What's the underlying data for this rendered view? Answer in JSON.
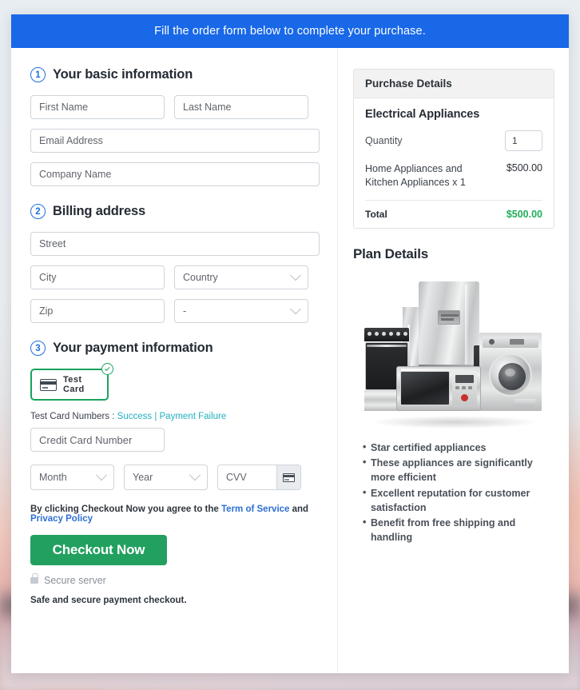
{
  "banner": {
    "text": "Fill the order form below to complete your purchase."
  },
  "sections": {
    "basic": {
      "step": "1",
      "title": "Your basic information",
      "fields": {
        "first_name": "First Name",
        "last_name": "Last Name",
        "email": "Email Address",
        "company": "Company Name"
      }
    },
    "billing": {
      "step": "2",
      "title": "Billing address",
      "fields": {
        "street": "Street",
        "city": "City",
        "country": "Country",
        "zip": "Zip",
        "state": "-"
      }
    },
    "payment": {
      "step": "3",
      "title": "Your payment information",
      "test_card_label": "Test Card",
      "test_numbers_prefix": "Test Card Numbers : ",
      "test_numbers_success": "Success",
      "test_numbers_separator": " | ",
      "test_numbers_failure": "Payment Failure",
      "card_number": "Credit Card Number",
      "month": "Month",
      "year": "Year",
      "cvv": "CVV",
      "terms_prefix": "By clicking Checkout Now you agree to the ",
      "terms_link_1": "Term of Service",
      "terms_middle": " and ",
      "terms_link_2": "Privacy Policy",
      "checkout_button": "Checkout Now",
      "secure_server": "Secure server",
      "safe_note": "Safe and secure payment checkout."
    }
  },
  "purchase": {
    "header": "Purchase Details",
    "product": "Electrical Appliances",
    "quantity_label": "Quantity",
    "quantity_value": "1",
    "line_item_desc": "Home Appliances and Kitchen Appliances x 1",
    "line_item_amount": "$500.00",
    "total_label": "Total",
    "total_amount": "$500.00"
  },
  "plan": {
    "title": "Plan Details",
    "bullets": [
      "Star certified appliances",
      "These appliances are significantly more efficient",
      "Excellent reputation for customer satisfaction",
      "Benefit from free shipping and handling"
    ]
  },
  "colors": {
    "banner_blue": "#1868e8",
    "step_blue": "#1d6fe0",
    "checkout_green": "#22a05f",
    "accent_green": "#1aa35c",
    "total_green": "#1fae5a",
    "link_teal": "#23b0bf",
    "link_blue": "#2d6fd4"
  }
}
